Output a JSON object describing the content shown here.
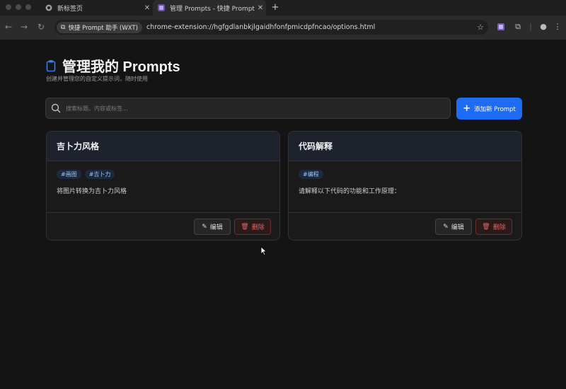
{
  "browser": {
    "tabs": [
      {
        "title": "新标签页",
        "active": false
      },
      {
        "title": "管理 Prompts - 快捷 Prompt 助",
        "active": true
      }
    ],
    "extension_chip": "快捷 Prompt 助手 (WXT)",
    "url": "chrome-extension://hgfgdlanbkjlgaidhfonfpmicdpfncao/options.html"
  },
  "page": {
    "title": "管理我的 Prompts",
    "subtitle": "创建并管理您的自定义提示词，随时使用",
    "search_placeholder": "搜索标题、内容或标签...",
    "add_button": "添加新 Prompt"
  },
  "cards": [
    {
      "title": "吉卜力风格",
      "tags": [
        "#画图",
        "#吉卜力"
      ],
      "content": "将图片转换为吉卜力风格",
      "edit_label": "编辑",
      "delete_label": "删除"
    },
    {
      "title": "代码解释",
      "tags": [
        "#编程"
      ],
      "content": "请解释以下代码的功能和工作原理：",
      "edit_label": "编辑",
      "delete_label": "删除"
    }
  ],
  "colors": {
    "accent": "#1e6cf5",
    "tag_text": "#9cc6ff",
    "danger": "#e46666"
  }
}
